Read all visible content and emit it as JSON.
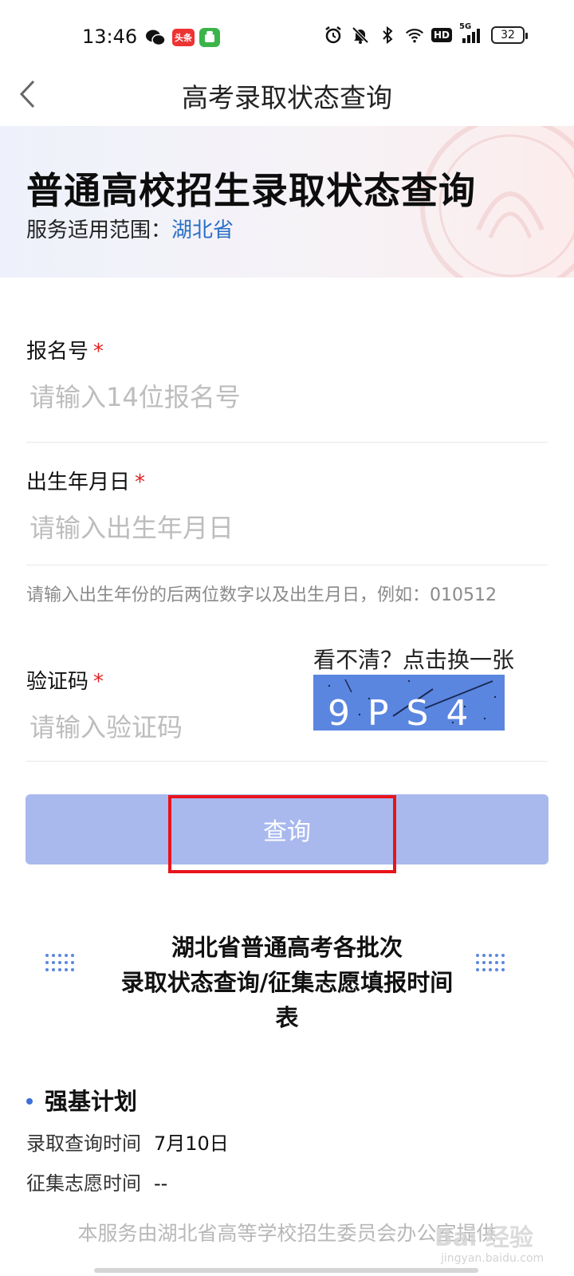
{
  "status_bar": {
    "time": "13:46",
    "apps": [
      "wechat-icon",
      "toutiao-icon",
      "android-store-icon"
    ],
    "toutiao_label": "头条",
    "network": "5G",
    "hd": "HD",
    "battery": "32"
  },
  "nav": {
    "title": "高考录取状态查询"
  },
  "banner": {
    "title": "普通高校招生录取状态查询",
    "scope_label": "服务适用范围：",
    "scope_value": "湖北省"
  },
  "form": {
    "reg_no": {
      "label": "报名号",
      "required": "*",
      "placeholder": "请输入14位报名号"
    },
    "birth": {
      "label": "出生年月日",
      "required": "*",
      "placeholder": "请输入出生年月日"
    },
    "birth_hint": "请输入出生年份的后两位数字以及出生月日，例如：010512",
    "captcha": {
      "label": "验证码",
      "required": "*",
      "placeholder": "请输入验证码",
      "refresh_text": "看不清？点击换一张",
      "image_text": "9PS4"
    },
    "submit_label": "查询"
  },
  "schedule": {
    "title_line1": "湖北省普通高考各批次",
    "title_line2": "录取状态查询/征集志愿填报时间",
    "title_line3": "表",
    "plans": [
      {
        "name": "强基计划",
        "query_time_label": "录取查询时间",
        "query_time": "7月10日",
        "recruit_time_label": "征集志愿时间",
        "recruit_time": "--"
      }
    ]
  },
  "footer": {
    "note": "本服务由湖北省高等学校招生委员会办公室提供",
    "watermark": "Bai 经验",
    "watermark_sub": "jingyan.baidu.com"
  },
  "colors": {
    "accent": "#2a6fc4",
    "required": "#e02020",
    "button_disabled": "#a9b9ee",
    "highlight": "#e8141a"
  }
}
